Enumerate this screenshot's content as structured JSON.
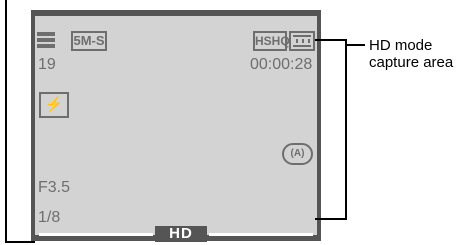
{
  "screen": {
    "shot_count": "19",
    "recording_time": "00:00:28",
    "aperture": "F3.5",
    "shutter_speed": "1/8",
    "resolution_badge": "5M-S",
    "quality_badge": "HSHQ",
    "flash_badge": "⚡",
    "stabilizer_badge": "(A)",
    "hd_banner": "HD"
  },
  "callout": {
    "line1": "HD mode",
    "line2": "capture area"
  },
  "colors": {
    "lcd_frame": "#555555",
    "lcd_screen": "#d3d3d3",
    "osd_text": "#6e6e6e"
  }
}
